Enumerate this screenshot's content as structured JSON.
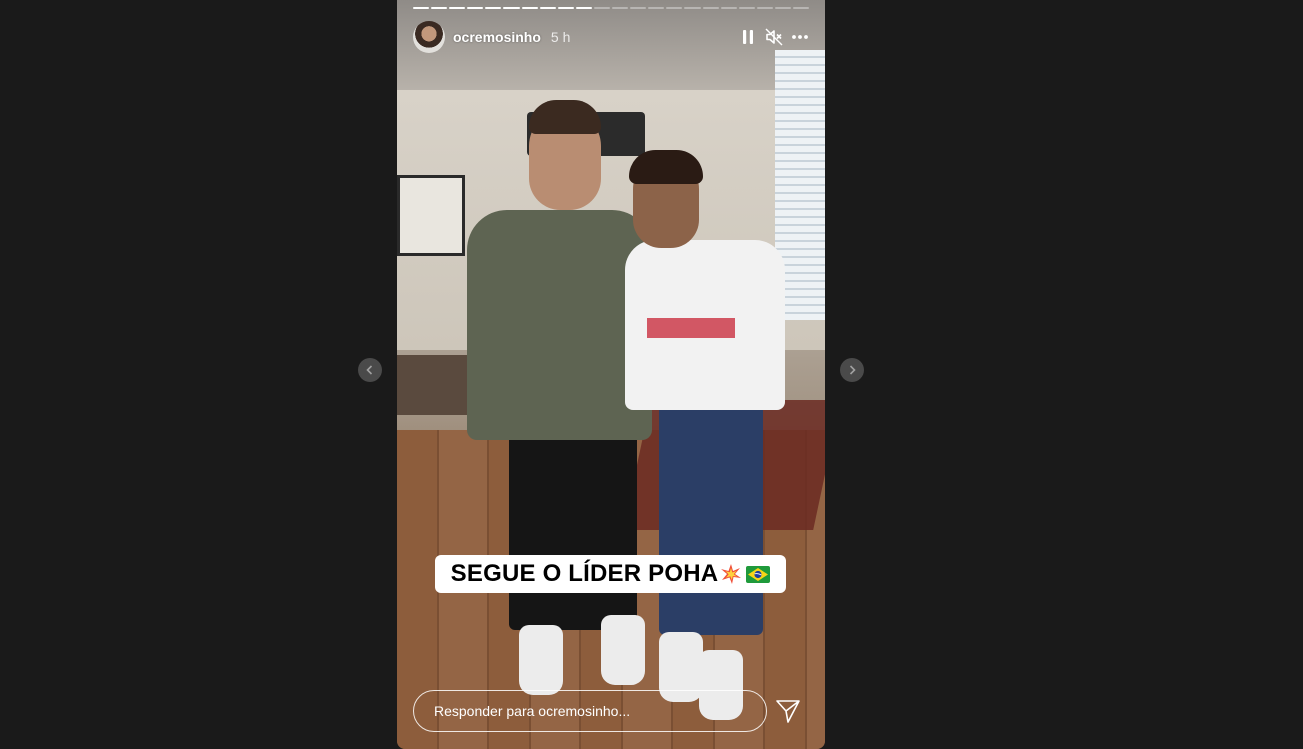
{
  "story": {
    "username": "ocremosinho",
    "timestamp": "5 h",
    "progress": {
      "total_segments": 22,
      "completed_segments": 10
    },
    "caption": {
      "text": "SEGUE O LÍDER POHA",
      "emojis": [
        "collision-emoji",
        "brazil-flag-emoji"
      ]
    },
    "reply": {
      "placeholder": "Responder para ocremosinho..."
    }
  },
  "controls": {
    "pause_icon": "pause-icon",
    "mute_icon": "muted-speaker-icon",
    "more_icon": "more-options-icon",
    "send_icon": "send-icon",
    "prev_icon": "chevron-left-icon",
    "next_icon": "chevron-right-icon"
  },
  "colors": {
    "page_background": "#1a1a1a",
    "overlay_text": "#ffffff",
    "caption_background": "#ffffff",
    "caption_text": "#000000"
  }
}
